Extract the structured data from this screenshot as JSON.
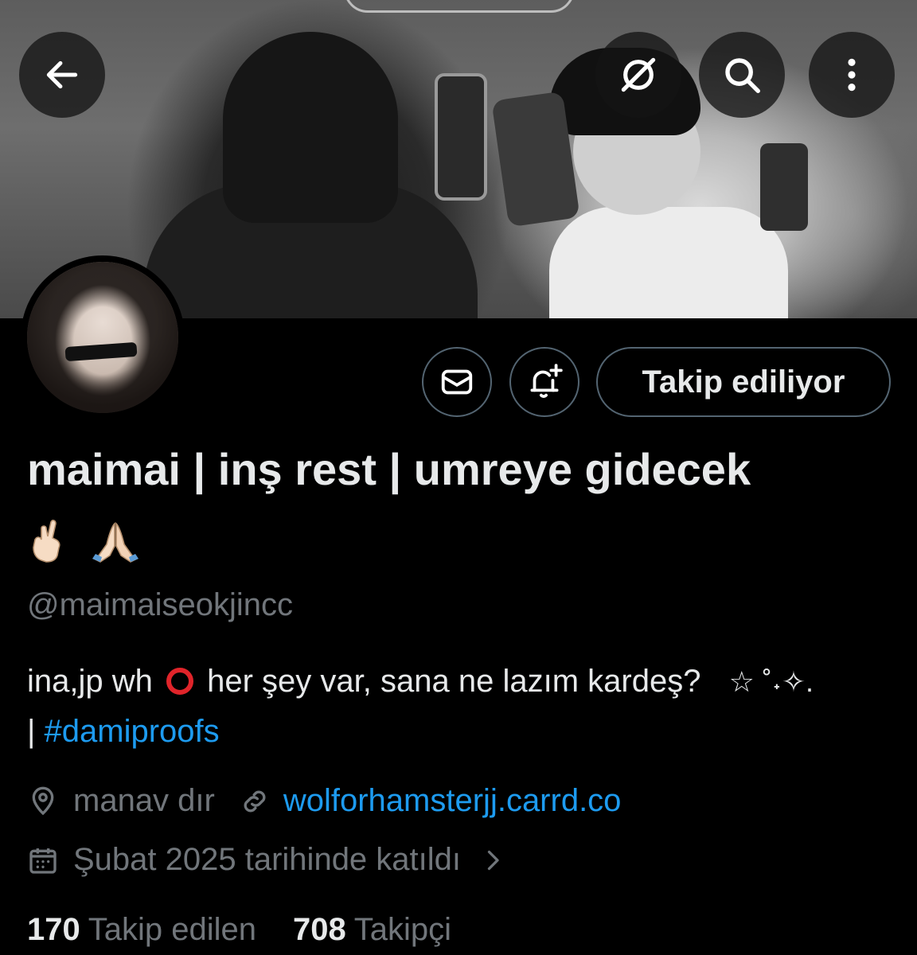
{
  "header": {
    "back_icon": "arrow-left-icon",
    "grok_icon": "grok-icon",
    "search_icon": "search-icon",
    "more_icon": "more-vertical-icon"
  },
  "profile": {
    "display_name": "maimai | inş rest | umreye gidecek",
    "name_emojis": [
      "🤞🏻",
      "🙏🏻"
    ],
    "handle": "@maimaiseokjincc",
    "bio_line1_a": "ina,jp wh",
    "bio_line1_b": "her şey var, sana ne lazım kardeş?",
    "bio_line1_c": "☆ ˚˖✧.",
    "bio_line2_sep": "| ",
    "bio_hashtag": "#damiproofs",
    "location": "manav dır",
    "website": "wolforhamsterjj.carrd.co",
    "joined": "Şubat 2025 tarihinde katıldı"
  },
  "actions": {
    "message_icon": "mail-icon",
    "notify_icon": "bell-plus-icon",
    "follow_label": "Takip ediliyor"
  },
  "stats": {
    "following_count": "170",
    "following_label": "Takip edilen",
    "followers_count": "708",
    "followers_label": "Takipçi"
  },
  "colors": {
    "background": "#000000",
    "text": "#e7e9ea",
    "muted": "#71767b",
    "link": "#1d9bf0",
    "border": "#536471"
  }
}
